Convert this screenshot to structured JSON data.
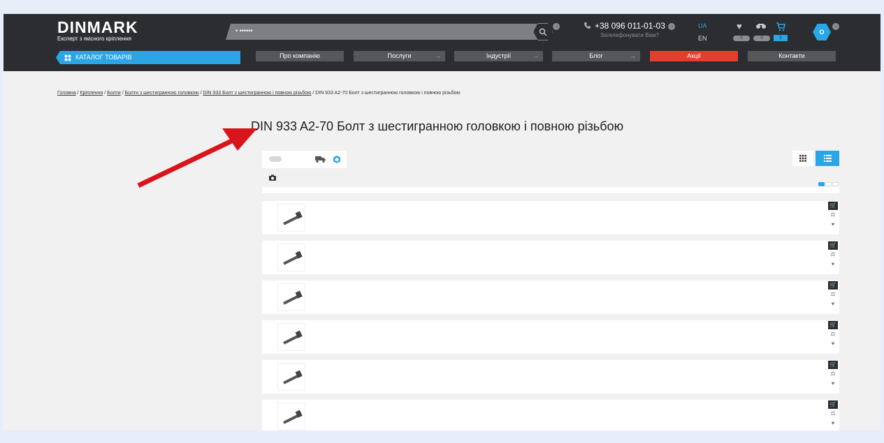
{
  "header": {
    "logo_title": "DINMARK",
    "logo_subtitle": "Експерт з якісного кріплення",
    "search_value": "• ••••••",
    "phone": "+38 096 011-01-03",
    "callback": "Зателефонувати Вам?",
    "lang_active": "UA",
    "lang_other": "EN",
    "wishlist_count": "0",
    "compare_count": "0",
    "cart_count": "1",
    "user_initial": "O"
  },
  "nav": {
    "catalog": "КАТАЛОГ ТОВАРІВ",
    "items": [
      "Про компанію",
      "Послуги",
      "Індустрії",
      "Блог",
      "Акції",
      "Контакти"
    ]
  },
  "breadcrumbs": {
    "items": [
      "Головна",
      "Кріплення",
      "Болти",
      "Болти з шестигранною головкою",
      "DIN 933 Болт з шестигранною і повною різьбою"
    ],
    "current": "DIN 933 A2-70 Болт з шестигранною головкою і повною різьбою"
  },
  "page": {
    "title": "DIN 933 A2-70 Болт з шестигранною головкою і повною різьбою"
  },
  "icons": {
    "grid": "grid-view-icon",
    "list": "list-view-icon",
    "truck": "truck-icon",
    "cube": "cube-icon",
    "camera": "camera-icon"
  },
  "colors": {
    "header_bg": "#2b2d30",
    "accent": "#2aa6e6",
    "promo": "#e43f2e",
    "annotation_arrow": "#d9141b"
  }
}
